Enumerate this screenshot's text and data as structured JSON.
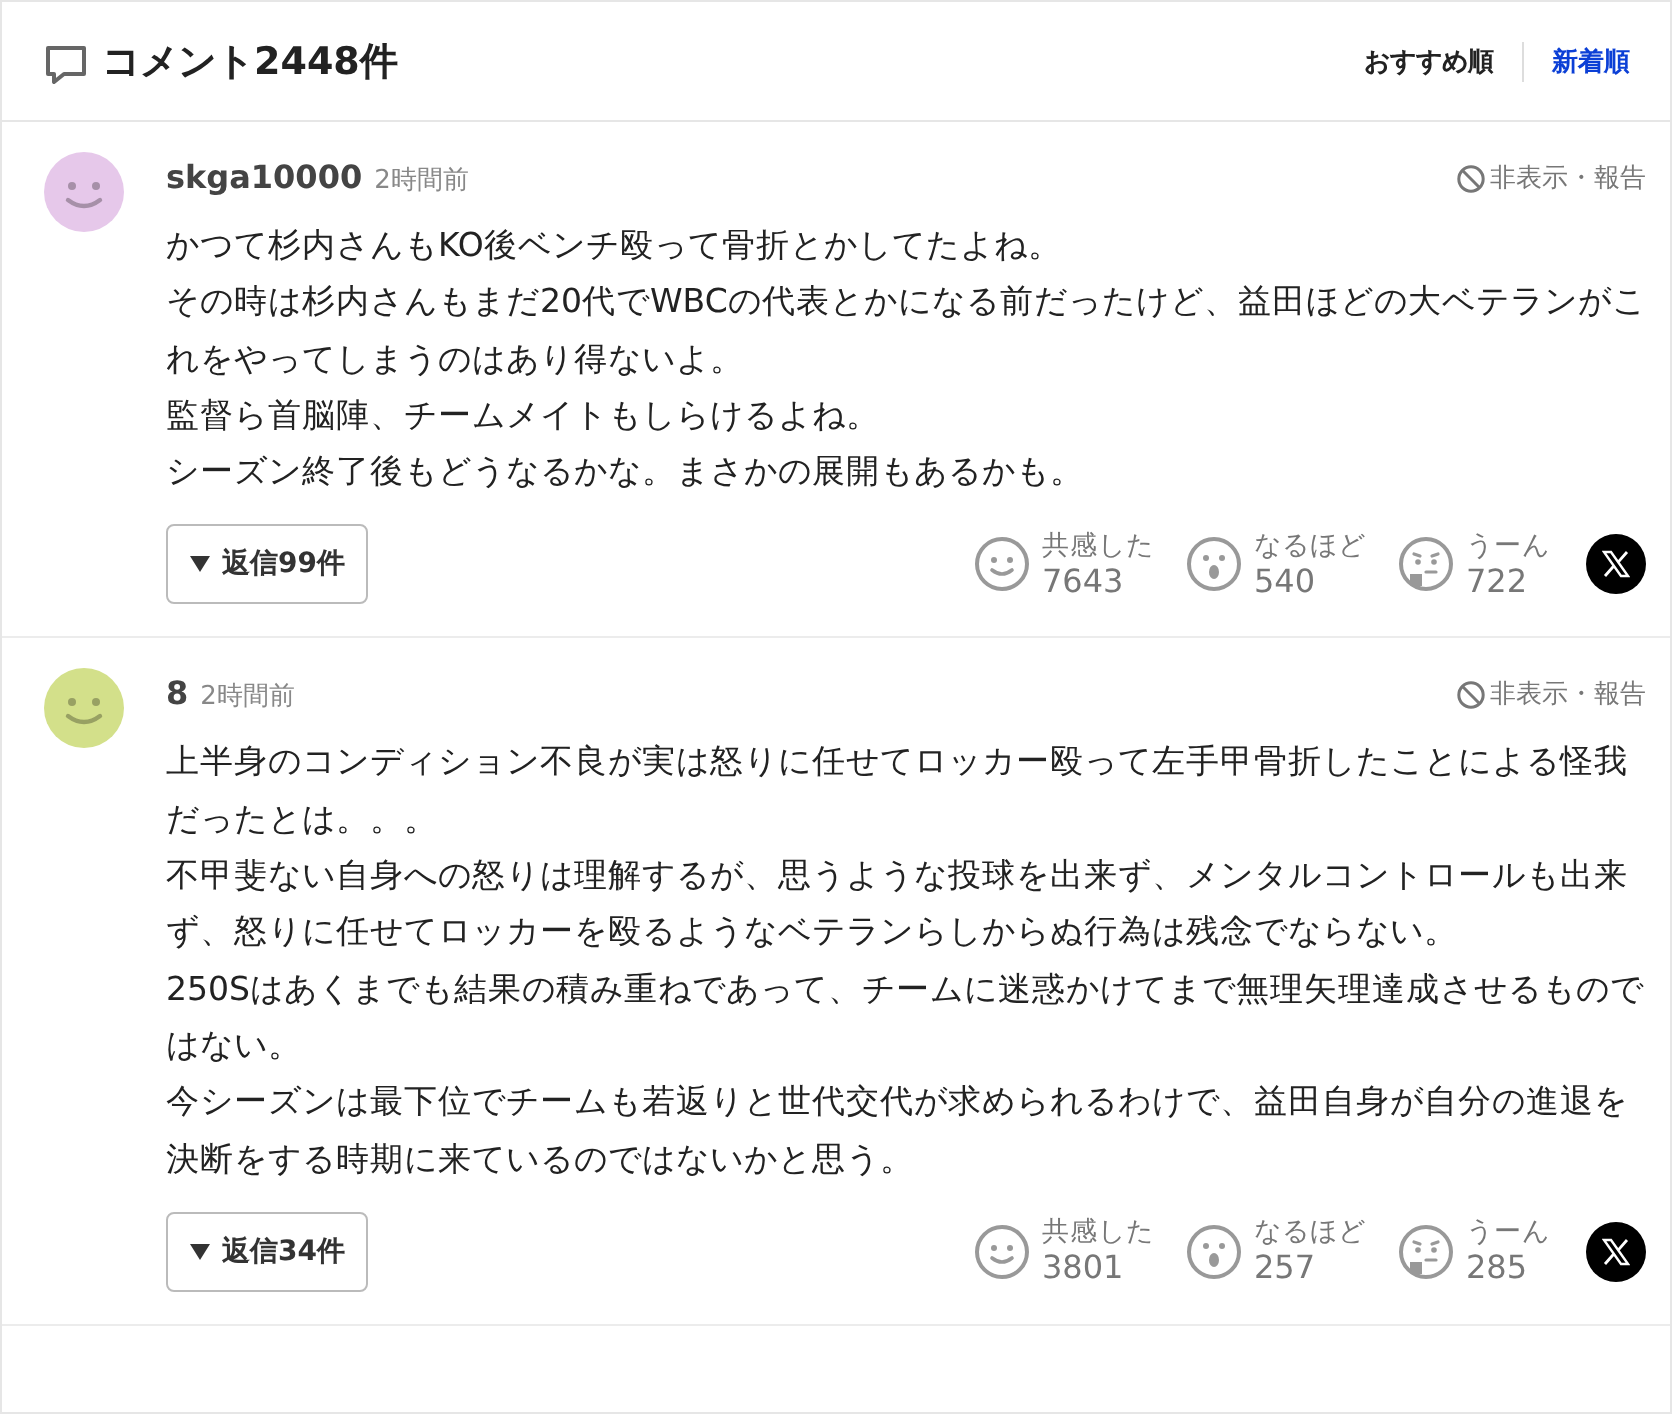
{
  "header": {
    "title": "コメント2448件",
    "sort_options": [
      {
        "label": "おすすめ順",
        "selected": false
      },
      {
        "label": "新着順",
        "selected": true
      }
    ]
  },
  "comments": [
    {
      "user": "skga10000",
      "time": "2時間前",
      "color": "#e6c8ea",
      "report": "非表示・報告",
      "body": [
        "かつて杉内さんもKO後ベンチ殴って骨折とかしてたよね。",
        "その時は杉内さんもまだ20代でWBCの代表とかになる前だったけど、益田ほどの大ベテランがこれをやってしまうのはあり得ないよ。",
        "監督ら首脳陣、チームメイトもしらけるよね。",
        "シーズン終了後もどうなるかな。まさかの展開もあるかも。"
      ],
      "replies": "返信99件",
      "reactions": [
        {
          "kind": "smile",
          "label": "共感した",
          "count": "7643"
        },
        {
          "kind": "surprised",
          "label": "なるほど",
          "count": "540"
        },
        {
          "kind": "thinking",
          "label": "うーん",
          "count": "722"
        }
      ]
    },
    {
      "user": "8",
      "time": "2時間前",
      "color": "#d3e08a",
      "report": "非表示・報告",
      "body": [
        "上半身のコンディション不良が実は怒りに任せてロッカー殴って左手甲骨折したことによる怪我だったとは。。。",
        "不甲斐ない自身への怒りは理解するが、思うような投球を出来ず、メンタルコントロールも出来ず、怒りに任せてロッカーを殴るようなベテランらしからぬ行為は残念でならない。",
        "250Sはあくまでも結果の積み重ねであって、チームに迷惑かけてまで無理矢理達成させるものではない。",
        "今シーズンは最下位でチームも若返りと世代交代が求められるわけで、益田自身が自分の進退を決断をする時期に来ているのではないかと思う。"
      ],
      "replies": "返信34件",
      "reactions": [
        {
          "kind": "smile",
          "label": "共感した",
          "count": "3801"
        },
        {
          "kind": "surprised",
          "label": "なるほど",
          "count": "257"
        },
        {
          "kind": "thinking",
          "label": "うーん",
          "count": "285"
        }
      ]
    }
  ]
}
